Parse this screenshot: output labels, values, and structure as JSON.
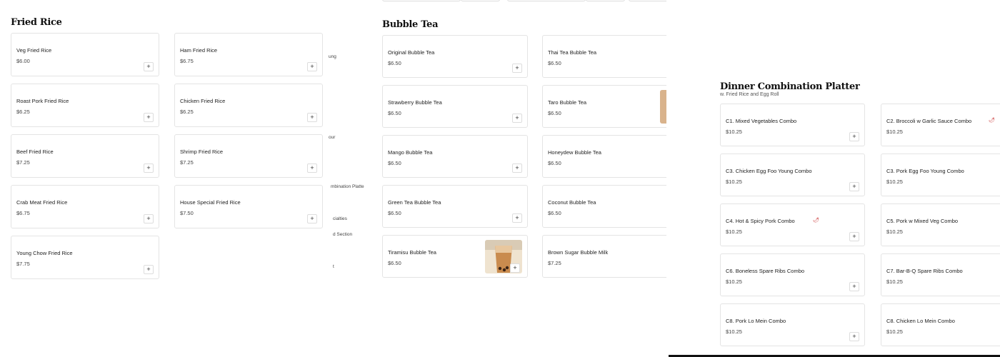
{
  "panel1": {
    "title": "Fried Rice",
    "items": [
      {
        "name": "Veg Fried Rice",
        "price": "$6.00"
      },
      {
        "name": "Ham Fried Rice",
        "price": "$6.75"
      },
      {
        "name": "Roast Pork Fried Rice",
        "price": "$6.25"
      },
      {
        "name": "Chicken Fried Rice",
        "price": "$6.25"
      },
      {
        "name": "Beef Fried Rice",
        "price": "$7.25"
      },
      {
        "name": "Shrimp Fried Rice",
        "price": "$7.25"
      },
      {
        "name": "Crab Meat Fried Rice",
        "price": "$6.75"
      },
      {
        "name": "House Special Fried Rice",
        "price": "$7.50"
      },
      {
        "name": "Young Chow Fried Rice",
        "price": "$7.75"
      }
    ]
  },
  "peek_text": [
    "ung",
    "our",
    "mbination Platte",
    "cialties",
    "d Section",
    "t"
  ],
  "panel2": {
    "title": "Bubble Tea",
    "items": [
      {
        "name": "Original Bubble Tea",
        "price": "$6.50"
      },
      {
        "name": "Thai Tea Bubble Tea",
        "price": "$6.50"
      },
      {
        "name": "Strawberry Bubble Tea",
        "price": "$6.50"
      },
      {
        "name": "Taro Bubble Tea",
        "price": "$6.50"
      },
      {
        "name": "Mango Bubble Tea",
        "price": "$6.50"
      },
      {
        "name": "Honeydew Bubble Tea",
        "price": "$6.50"
      },
      {
        "name": "Green Tea Bubble Tea",
        "price": "$6.50"
      },
      {
        "name": "Coconut Bubble Tea",
        "price": "$6.50"
      },
      {
        "name": "Tiramisu Bubble Tea",
        "price": "$6.50"
      },
      {
        "name": "Brown Sugar Bubble Milk",
        "price": "$7.25"
      }
    ]
  },
  "panel3": {
    "title": "Dinner Combination Platter",
    "subtitle": "w. Fried Rice and Egg Roll",
    "items": [
      {
        "name": "C1. Mixed Vegetables Combo",
        "price": "$10.25"
      },
      {
        "name": "C2. Broccoli w Garlic Sauce Combo",
        "price": "$10.25"
      },
      {
        "name": "C3. Chicken Egg Foo Young Combo",
        "price": "$10.25"
      },
      {
        "name": "C3. Pork Egg Foo Young Combo",
        "price": "$10.25"
      },
      {
        "name": "C4. Hot & Spicy Pork Combo",
        "price": "$10.25"
      },
      {
        "name": "C5. Pork w Mixed Veg Combo",
        "price": "$10.25"
      },
      {
        "name": "C6. Boneless Spare Ribs Combo",
        "price": "$10.25"
      },
      {
        "name": "C7. Bar-B-Q Spare Ribs Combo",
        "price": "$10.25"
      },
      {
        "name": "C8. Pork Lo Mein Combo",
        "price": "$10.25"
      },
      {
        "name": "C8. Chicken Lo Mein Combo",
        "price": "$10.25"
      }
    ]
  },
  "add_label": "+",
  "spicy_icon": "chili-pepper-icon",
  "colors": {
    "spicy": "#c62828",
    "border": "#e4e4e4"
  }
}
